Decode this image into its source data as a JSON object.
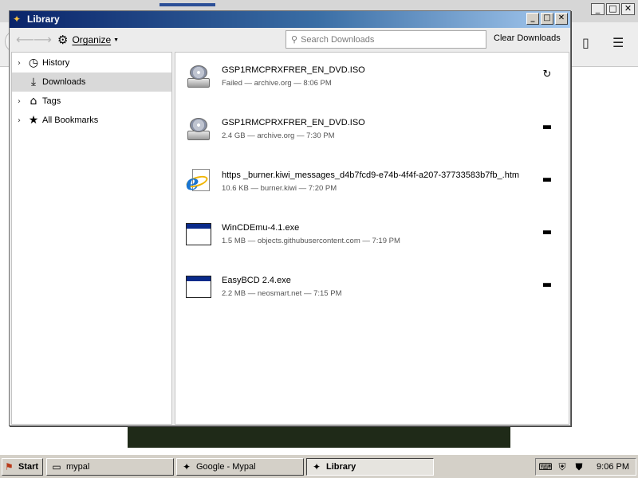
{
  "background_browser": {
    "window_buttons": [
      "_",
      "□",
      "✕"
    ]
  },
  "library": {
    "title": "Library",
    "window_buttons": [
      "_",
      "□",
      "✕"
    ],
    "toolbar": {
      "back_icon": "back-arrow-icon",
      "forward_icon": "forward-arrow-icon",
      "organize_label": "Organize",
      "search_placeholder": "Search Downloads",
      "clear_label": "Clear Downloads"
    },
    "sidebar": {
      "items": [
        {
          "label": "History",
          "icon": "clock-icon",
          "expandable": true,
          "selected": false
        },
        {
          "label": "Downloads",
          "icon": "download-icon",
          "expandable": false,
          "selected": true
        },
        {
          "label": "Tags",
          "icon": "tag-icon",
          "expandable": true,
          "selected": false
        },
        {
          "label": "All Bookmarks",
          "icon": "star-icon",
          "expandable": true,
          "selected": false
        }
      ]
    },
    "downloads": [
      {
        "name": "GSP1RMCPRXFRER_EN_DVD.ISO",
        "status": "Failed — archive.org — 8:06 PM",
        "file_icon": "disc-icon",
        "action_icon": "retry-icon"
      },
      {
        "name": "GSP1RMCPRXFRER_EN_DVD.ISO",
        "status": "2.4 GB — archive.org — 7:30 PM",
        "file_icon": "disc-icon",
        "action_icon": "folder-icon"
      },
      {
        "name": "https _burner.kiwi_messages_d4b7fcd9-e74b-4f4f-a207-37733583b7fb_.htm",
        "status": "10.6 KB — burner.kiwi — 7:20 PM",
        "file_icon": "ie-document-icon",
        "action_icon": "folder-icon"
      },
      {
        "name": "WinCDEmu-4.1.exe",
        "status": "1.5 MB — objects.githubusercontent.com — 7:19 PM",
        "file_icon": "executable-icon",
        "action_icon": "folder-icon"
      },
      {
        "name": "EasyBCD 2.4.exe",
        "status": "2.2 MB — neosmart.net — 7:15 PM",
        "file_icon": "executable-icon",
        "action_icon": "folder-icon"
      }
    ]
  },
  "taskbar": {
    "start_label": "Start",
    "tasks": [
      {
        "label": "mypal",
        "icon": "folder-icon",
        "active": false
      },
      {
        "label": "Google - Mypal",
        "icon": "mypal-icon",
        "active": false
      },
      {
        "label": "Library",
        "icon": "mypal-icon",
        "active": true
      }
    ],
    "tray_icons": [
      "keyboard-icon",
      "shield-icon",
      "security-icon"
    ],
    "clock": "9:06 PM"
  }
}
